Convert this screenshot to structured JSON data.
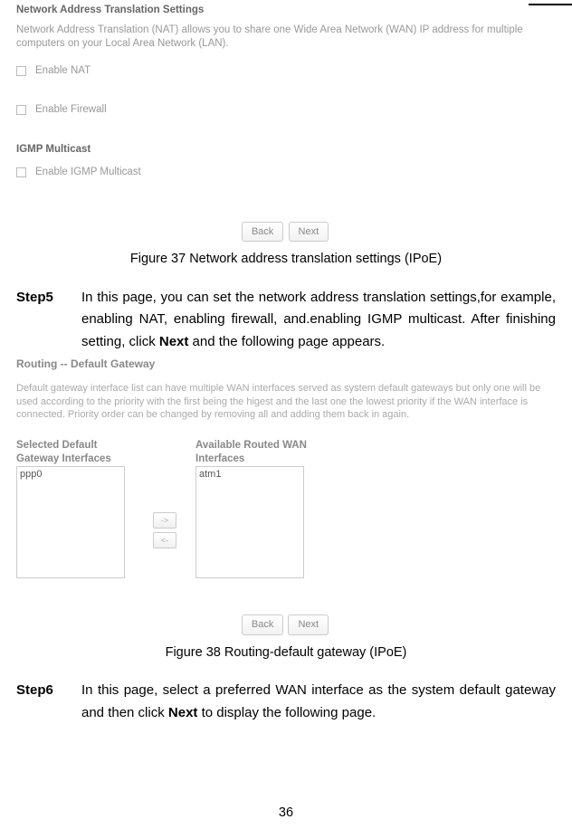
{
  "panel1": {
    "title": "Network Address Translation Settings",
    "desc": "Network Address Translation (NAT) allows you to share one Wide Area Network (WAN) IP address for multiple computers on your Local Area Network (LAN).",
    "enable_nat": "Enable NAT",
    "enable_firewall": "Enable Firewall",
    "igmp_title": "IGMP Multicast",
    "enable_igmp": "Enable IGMP Multicast",
    "back": "Back",
    "next": "Next"
  },
  "caption1": "Figure 37 Network address translation settings (IPoE)",
  "step5": {
    "label": "Step5",
    "text_a": "In this page, you can set the network address translation settings,for example, enabling NAT, enabling firewall, and.enabling IGMP multicast. After finishing setting, click ",
    "next": "Next",
    "text_b": " and the following page appears."
  },
  "panel2": {
    "title": "Routing -- Default Gateway",
    "desc": "Default gateway interface list can have multiple WAN interfaces served as system default gateways but only one will be used according to the priority with the first being the higest and the last one the lowest priority if the WAN interface is connected. Priority order can be changed by removing all and adding them back in again.",
    "col1_head": "Selected Default Gateway Interfaces",
    "col2_head": "Available Routed WAN Interfaces",
    "list1": "ppp0",
    "list2": "atm1",
    "move_right": "->",
    "move_left": "<-",
    "back": "Back",
    "next": "Next"
  },
  "caption2": "Figure 38 Routing-default gateway (IPoE)",
  "step6": {
    "label": "Step6",
    "text_a": "In this page, select a preferred WAN interface as the system default gateway and then click ",
    "next": "Next",
    "text_b": " to display the following page."
  },
  "page_num": "36"
}
